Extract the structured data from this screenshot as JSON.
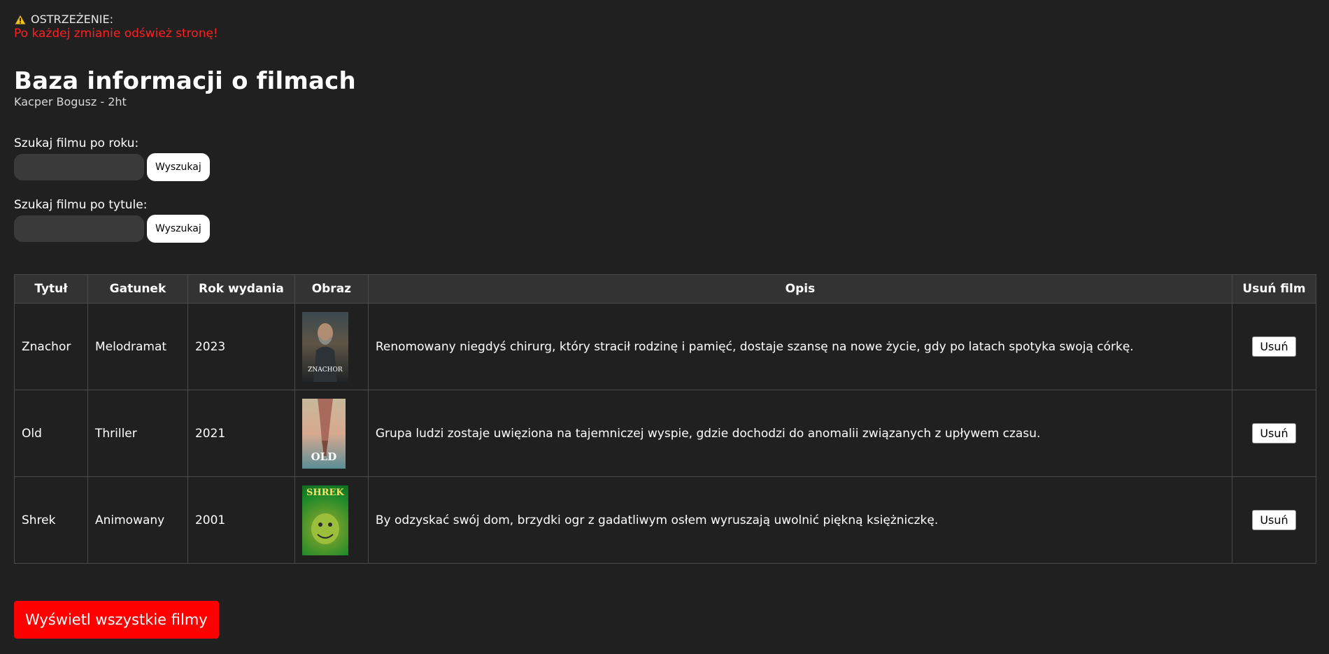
{
  "warning": {
    "icon": "warning-icon",
    "heading": "OSTRZEŻENIE:",
    "message": "Po każdej zmianie odśwież stronę!",
    "message_color": "#ff1f1f"
  },
  "header": {
    "title": "Baza informacji o filmach",
    "subtitle": "Kacper Bogusz - 2ht"
  },
  "search_year": {
    "label": "Szukaj filmu po roku:",
    "value": "",
    "placeholder": "",
    "button_label": "Wyszukaj"
  },
  "search_title": {
    "label": "Szukaj filmu po tytule:",
    "value": "",
    "placeholder": "",
    "button_label": "Wyszukaj"
  },
  "table": {
    "headers": [
      "Tytuł",
      "Gatunek",
      "Rok wydania",
      "Obraz",
      "Opis",
      "Usuń film"
    ],
    "rows": [
      {
        "title": "Znachor",
        "genre": "Melodramat",
        "year": "2023",
        "poster_text": "ZNACHOR",
        "description": "Renomowany niegdyś chirurg, który stracił rodzinę i pamięć, dostaje szansę na nowe życie, gdy po latach spotyka swoją córkę.",
        "delete_label": "Usuń"
      },
      {
        "title": "Old",
        "genre": "Thriller",
        "year": "2021",
        "poster_text": "OLD",
        "description": "Grupa ludzi zostaje uwięziona na tajemniczej wyspie, gdzie dochodzi do anomalii związanych z upływem czasu.",
        "delete_label": "Usuń"
      },
      {
        "title": "Shrek",
        "genre": "Animowany",
        "year": "2001",
        "poster_text": "SHREK",
        "description": "By odzyskać swój dom, brzydki ogr z gadatliwym osłem wyruszają uwolnić piękną księżniczkę.",
        "delete_label": "Usuń"
      }
    ]
  },
  "show_all_label": "Wyświetl wszystkie filmy",
  "colors": {
    "background": "#202020",
    "accent_red": "#ff0000",
    "table_header_bg": "#333333",
    "input_bg": "#3a3a3a"
  }
}
